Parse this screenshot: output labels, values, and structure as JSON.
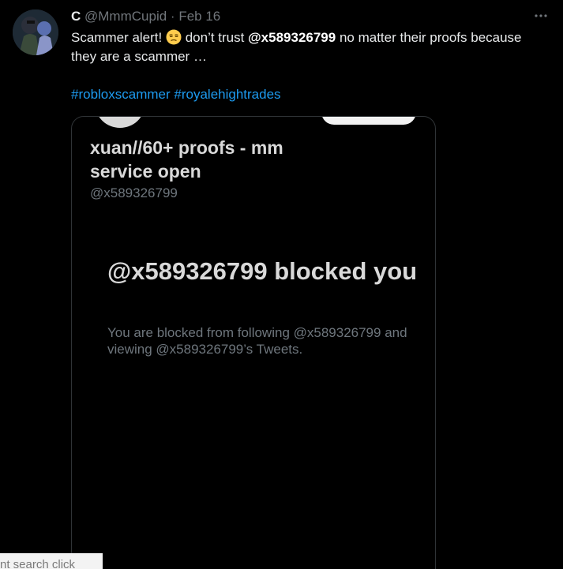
{
  "author": {
    "name": "C",
    "handle": "@MmmCupid",
    "separator": "·",
    "date": "Feb 16"
  },
  "more_button": {
    "icon": "more-horizontal-icon",
    "label": "···"
  },
  "tweet": {
    "text_before_emoji": "Scammer alert! ",
    "emoji": "unamused-face",
    "text_mid": " don’t trust ",
    "mention": "@x589326799",
    "text_after": " no matter their proofs because they are a scammer …",
    "hashtags": [
      "#robloxscammer",
      "#royalehightrades"
    ]
  },
  "media": {
    "profile_name": "xuan//60+ proofs - mm service open",
    "profile_handle": "@x589326799",
    "blocked_title": "@x589326799 blocked you",
    "blocked_description": "You are blocked from following @x589326799 and viewing @x589326799’s Tweets."
  },
  "overlay": {
    "text": "nt search click"
  },
  "colors": {
    "background": "#000000",
    "text": "#e7e9ea",
    "muted": "#71767b",
    "accent": "#1d9bf0",
    "border": "#2f3336"
  }
}
